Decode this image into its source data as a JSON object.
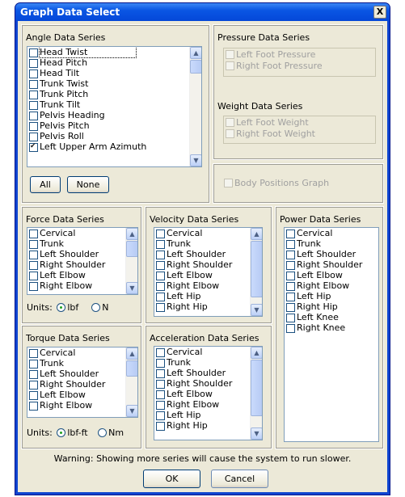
{
  "window": {
    "title": "Graph Data Select",
    "close_label": "X"
  },
  "angle": {
    "title": "Angle Data Series",
    "items": [
      {
        "label": "Head Twist",
        "checked": false
      },
      {
        "label": "Head Pitch",
        "checked": false
      },
      {
        "label": "Head Tilt",
        "checked": false
      },
      {
        "label": "Trunk Twist",
        "checked": false
      },
      {
        "label": "Trunk Pitch",
        "checked": false
      },
      {
        "label": "Trunk Tilt",
        "checked": false
      },
      {
        "label": "Pelvis Heading",
        "checked": false
      },
      {
        "label": "Pelvis Pitch",
        "checked": false
      },
      {
        "label": "Pelvis Roll",
        "checked": false
      },
      {
        "label": "Left Upper Arm Azimuth",
        "checked": true
      }
    ],
    "all_label": "All",
    "none_label": "None"
  },
  "pressure": {
    "title": "Pressure Data Series",
    "items": [
      "Left Foot Pressure",
      "Right Foot Pressure"
    ]
  },
  "weight": {
    "title": "Weight Data Series",
    "items": [
      "Left Foot Weight",
      "Right Foot Weight"
    ]
  },
  "body_positions": {
    "label": "Body Positions Graph"
  },
  "force": {
    "title": "Force Data Series",
    "items": [
      "Cervical",
      "Trunk",
      "Left Shoulder",
      "Right Shoulder",
      "Left Elbow",
      "Right Elbow"
    ],
    "units_label": "Units:",
    "unit_options": [
      "lbf",
      "N"
    ],
    "selected_unit": "lbf"
  },
  "torque": {
    "title": "Torque Data Series",
    "items": [
      "Cervical",
      "Trunk",
      "Left Shoulder",
      "Right Shoulder",
      "Left Elbow",
      "Right Elbow"
    ],
    "units_label": "Units:",
    "unit_options": [
      "lbf-ft",
      "Nm"
    ],
    "selected_unit": "lbf-ft"
  },
  "velocity": {
    "title": "Velocity Data Series",
    "items": [
      "Cervical",
      "Trunk",
      "Left Shoulder",
      "Right Shoulder",
      "Left Elbow",
      "Right Elbow",
      "Left Hip",
      "Right Hip"
    ]
  },
  "acceleration": {
    "title": "Acceleration Data Series",
    "items": [
      "Cervical",
      "Trunk",
      "Left Shoulder",
      "Right Shoulder",
      "Left Elbow",
      "Right Elbow",
      "Left Hip",
      "Right Hip"
    ]
  },
  "power": {
    "title": "Power Data Series",
    "items": [
      "Cervical",
      "Trunk",
      "Left Shoulder",
      "Right Shoulder",
      "Left Elbow",
      "Right Elbow",
      "Left Hip",
      "Right Hip",
      "Left Knee",
      "Right Knee"
    ]
  },
  "footer": {
    "warning": "Warning: Showing more series will cause the system to run slower.",
    "ok_label": "OK",
    "cancel_label": "Cancel"
  }
}
